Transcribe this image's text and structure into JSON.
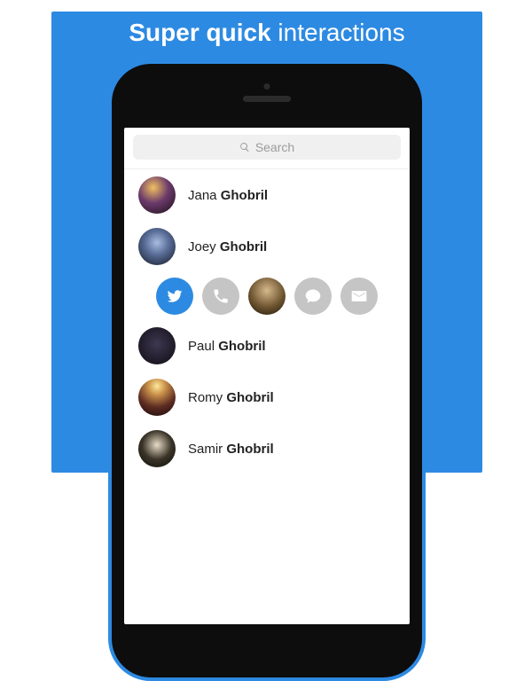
{
  "headline": {
    "bold": "Super quick",
    "rest": "interactions"
  },
  "search": {
    "placeholder": "Search"
  },
  "contacts": [
    {
      "first": "Jana",
      "last": "Ghobril"
    },
    {
      "first": "Joey",
      "last": "Ghobril"
    },
    {
      "first": "Paul",
      "last": "Ghobril"
    },
    {
      "first": "Romy",
      "last": "Ghobril"
    },
    {
      "first": "Samir",
      "last": "Ghobril"
    }
  ],
  "quick_actions": [
    {
      "name": "twitter",
      "active": true
    },
    {
      "name": "phone",
      "active": false
    },
    {
      "name": "avatar",
      "active": false
    },
    {
      "name": "message",
      "active": false
    },
    {
      "name": "mail",
      "active": false
    }
  ]
}
